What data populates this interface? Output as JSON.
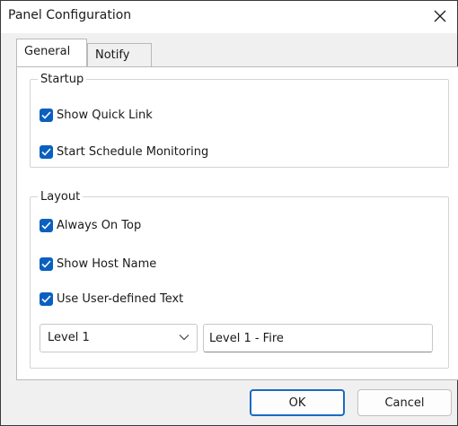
{
  "window": {
    "title": "Panel Configuration",
    "close_icon": "close-icon"
  },
  "tabs": [
    {
      "label": "General",
      "active": true
    },
    {
      "label": "Notify",
      "active": false
    }
  ],
  "startup": {
    "title": "Startup",
    "options": [
      {
        "label": "Show Quick Link",
        "checked": true
      },
      {
        "label": "Start Schedule Monitoring",
        "checked": true
      }
    ]
  },
  "layout": {
    "title": "Layout",
    "options": [
      {
        "label": "Always On Top",
        "checked": true
      },
      {
        "label": "Show Host Name",
        "checked": true
      },
      {
        "label": "Use User-defined Text",
        "checked": true
      }
    ],
    "level_select": {
      "value": "Level 1"
    },
    "text_field": {
      "value": "Level 1 - Fire"
    }
  },
  "buttons": {
    "ok": "OK",
    "cancel": "Cancel"
  },
  "colors": {
    "checkbox_accent": "#0a5fc0",
    "default_button_border": "#1a6ac4"
  }
}
